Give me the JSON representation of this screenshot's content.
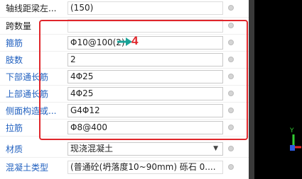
{
  "rows": [
    {
      "label": "轴线距梁左...",
      "value": "(150)",
      "labelColor": "black"
    },
    {
      "label": "跨数量",
      "value": "",
      "labelColor": "black"
    },
    {
      "label": "箍筋",
      "value": "Φ10@100(2)",
      "labelColor": "blue"
    },
    {
      "label": "肢数",
      "value": "2",
      "labelColor": "blue"
    },
    {
      "label": "下部通长筋",
      "value": "4Φ25",
      "labelColor": "blue"
    },
    {
      "label": "上部通长筋",
      "value": "4Φ25",
      "labelColor": "blue"
    },
    {
      "label": "侧面构造或...",
      "value": "G4Φ12",
      "labelColor": "blue"
    },
    {
      "label": "拉筋",
      "value": "Φ8@400",
      "labelColor": "blue"
    },
    {
      "label": "材质",
      "value": "现浇混凝土",
      "labelColor": "blue"
    },
    {
      "label": "混凝土类型",
      "value": "(普通砼(坍落度10~90mm)  砾石 0....",
      "labelColor": "blue"
    }
  ],
  "annotation": {
    "number": "4"
  },
  "axis": {
    "y_label": "Y"
  },
  "colors": {
    "label_blue": "#1f5fbf",
    "highlight_red": "#e0262b",
    "annotation_teal": "#1aa398"
  }
}
